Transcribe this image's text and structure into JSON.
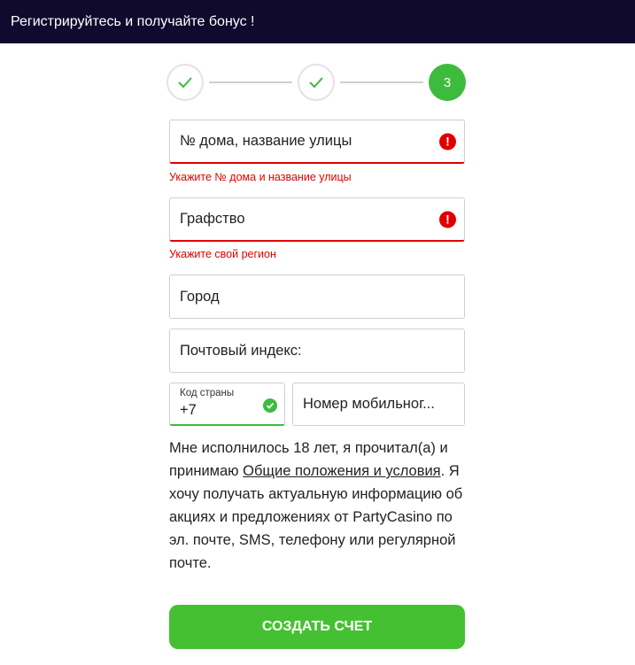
{
  "header": {
    "title": "Регистрируйтесь и получайте бонус !"
  },
  "stepper": {
    "step3_label": "3"
  },
  "fields": {
    "street": {
      "value": "№ дома, название улицы",
      "error": "Укажите № дома и название улицы"
    },
    "county": {
      "value": "Графство",
      "error": "Укажите свой регион"
    },
    "city": {
      "value": "Город"
    },
    "postcode": {
      "value": "Почтовый индекс:"
    },
    "country_code": {
      "label": "Код страны",
      "value": "+7"
    },
    "phone": {
      "value": "Номер мобильног..."
    }
  },
  "terms": {
    "before": "Мне исполнилось 18 лет, я прочитал(а) и принимаю ",
    "link": "Общие положения и условия",
    "after": ". Я хочу получать актуальную информацию об акциях и предложениях от PartyCasino по эл. почте, SMS, телефону или регулярной почте."
  },
  "submit": {
    "label": "СОЗДАТЬ СЧЕТ"
  },
  "colors": {
    "header_bg": "#0f0a2e",
    "accent_green": "#3dbb3d",
    "error_red": "#e10000"
  }
}
